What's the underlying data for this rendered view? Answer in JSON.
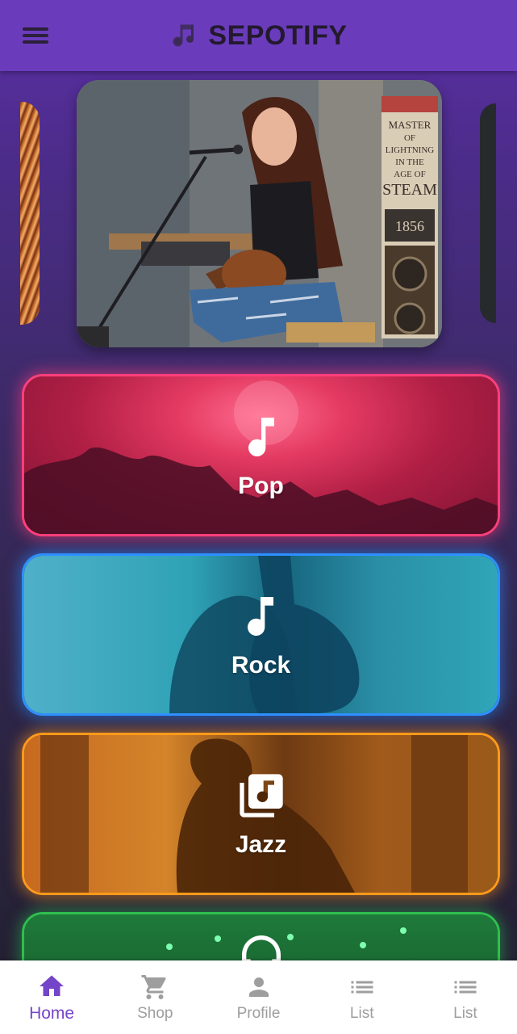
{
  "app": {
    "title": "SEPOTIFY",
    "accent_color": "#6a3cbc"
  },
  "genres": [
    {
      "label": "Pop",
      "icon": "music-note-icon",
      "color": "#ff3f7a"
    },
    {
      "label": "Rock",
      "icon": "music-note-icon",
      "color": "#2e90ff"
    },
    {
      "label": "Jazz",
      "icon": "music-library-icon",
      "color": "#ff9a1a"
    },
    {
      "label": "",
      "icon": "headphones-icon",
      "color": "#2fbf4f"
    }
  ],
  "poster_text": {
    "line1": "MASTER",
    "line2": "OF",
    "line3": "LIGHTNING",
    "line4": "IN THE",
    "line5": "AGE OF",
    "line6": "STEAM",
    "number": "1856"
  },
  "bottom_nav": [
    {
      "label": "Home",
      "icon": "home-icon",
      "active": true
    },
    {
      "label": "Shop",
      "icon": "cart-icon",
      "active": false
    },
    {
      "label": "Profile",
      "icon": "person-icon",
      "active": false
    },
    {
      "label": "List",
      "icon": "list-icon",
      "active": false
    },
    {
      "label": "List",
      "icon": "list-icon",
      "active": false
    }
  ]
}
